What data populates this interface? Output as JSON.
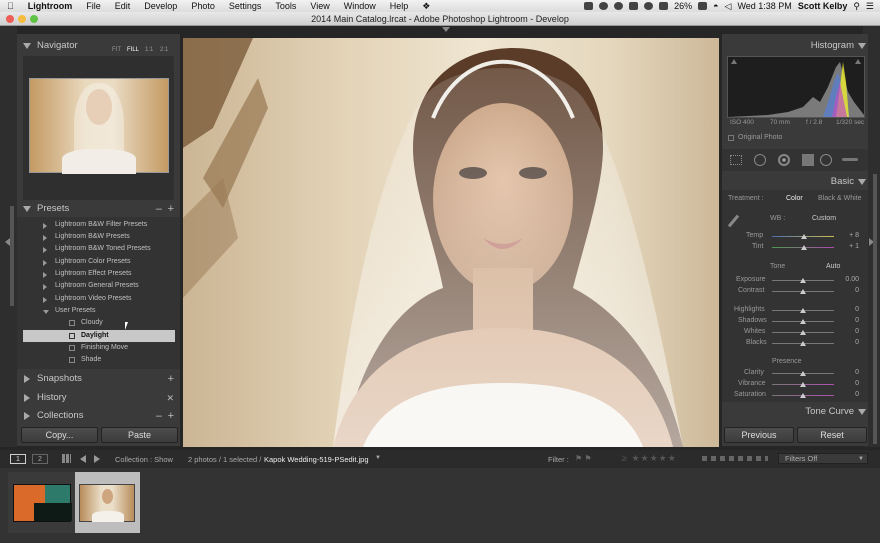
{
  "menubar": {
    "app": "Lightroom",
    "items": [
      "File",
      "Edit",
      "Develop",
      "Photo",
      "Settings",
      "Tools",
      "View",
      "Window",
      "Help"
    ],
    "battery": "26%",
    "clock": "Wed 1:38 PM",
    "user": "Scott Kelby"
  },
  "window": {
    "title": "2014 Main Catalog.lrcat - Adobe Photoshop Lightroom - Develop"
  },
  "navigator": {
    "title": "Navigator",
    "zoom": [
      "FIT",
      "FILL",
      "1:1",
      "2:1"
    ]
  },
  "presets": {
    "title": "Presets",
    "folders": [
      "Lightroom B&W Filter Presets",
      "Lightroom B&W Presets",
      "Lightroom B&W Toned Presets",
      "Lightroom Color Presets",
      "Lightroom Effect Presets",
      "Lightroom General Presets",
      "Lightroom Video Presets",
      "User Presets"
    ],
    "user_items": [
      "Cloudy",
      "Daylight",
      "Finishing Move",
      "Shade"
    ],
    "selected": "Daylight"
  },
  "snapshots": {
    "title": "Snapshots"
  },
  "history": {
    "title": "History"
  },
  "collections": {
    "title": "Collections"
  },
  "left_buttons": {
    "copy": "Copy...",
    "paste": "Paste"
  },
  "histogram": {
    "title": "Histogram",
    "iso": "ISO 400",
    "focal": "70 mm",
    "aperture": "f / 2.8",
    "shutter": "1/320 sec",
    "original_photo": "Original Photo"
  },
  "basic": {
    "title": "Basic",
    "treatment_label": "Treatment :",
    "color": "Color",
    "bw": "Black & White",
    "wb_label": "WB :",
    "wb_value": "Custom",
    "temp": {
      "label": "Temp",
      "value": "+ 8",
      "pos": 0.52
    },
    "tint": {
      "label": "Tint",
      "value": "+ 1",
      "pos": 0.51
    },
    "tone_label": "Tone",
    "auto": "Auto",
    "exposure": {
      "label": "Exposure",
      "value": "0.00",
      "pos": 0.5
    },
    "contrast": {
      "label": "Contrast",
      "value": "0",
      "pos": 0.5
    },
    "highlights": {
      "label": "Highlights",
      "value": "0",
      "pos": 0.5
    },
    "shadows": {
      "label": "Shadows",
      "value": "0",
      "pos": 0.5
    },
    "whites": {
      "label": "Whites",
      "value": "0",
      "pos": 0.5
    },
    "blacks": {
      "label": "Blacks",
      "value": "0",
      "pos": 0.5
    },
    "presence_label": "Presence",
    "clarity": {
      "label": "Clarity",
      "value": "0",
      "pos": 0.5
    },
    "vibrance": {
      "label": "Vibrance",
      "value": "0",
      "pos": 0.5
    },
    "saturation": {
      "label": "Saturation",
      "value": "0",
      "pos": 0.5
    }
  },
  "tone_curve": {
    "title": "Tone Curve"
  },
  "right_buttons": {
    "previous": "Previous",
    "reset": "Reset"
  },
  "filmstrip": {
    "view1": "1",
    "view2": "2",
    "source": "Collection : Show",
    "count": "2 photos / 1 selected /",
    "filename": "Kapok Wedding-519-PSedit.jpg",
    "filter_label": "Filter :",
    "filter_value": "Filters Off"
  }
}
